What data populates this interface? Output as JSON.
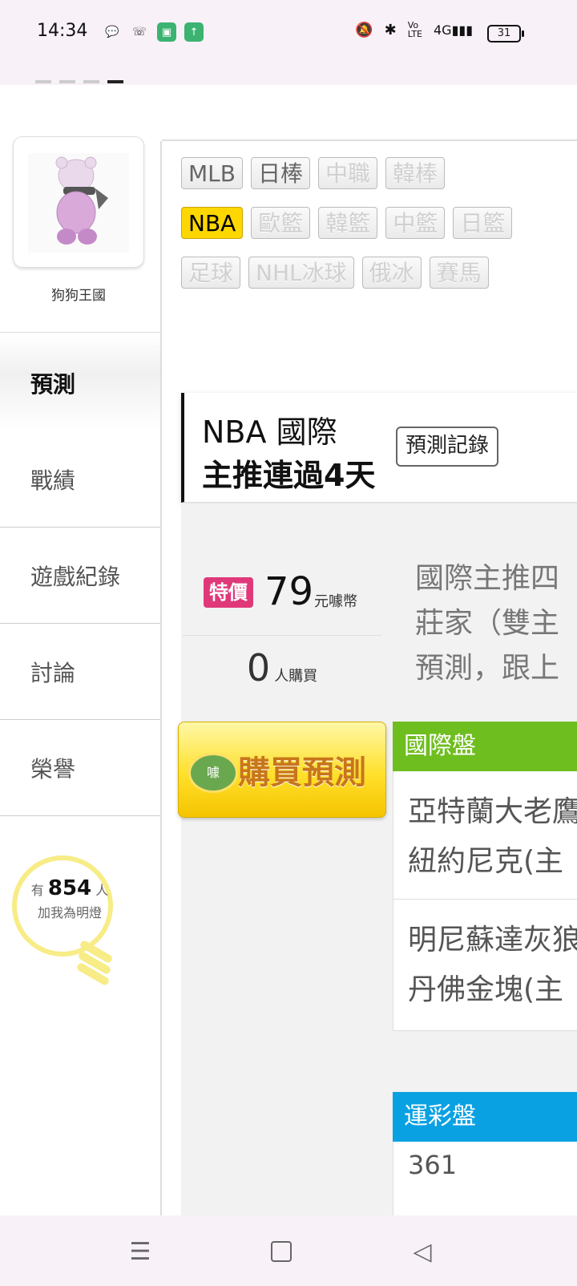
{
  "status_bar": {
    "time": "14:34",
    "battery": "31",
    "left_icons": [
      "chat-bubble-icon",
      "call-icon",
      "green-app-icon",
      "upload-icon"
    ],
    "right_icons": [
      "mute-icon",
      "bluetooth-icon",
      "volte-icon",
      "4g-signal-icon"
    ]
  },
  "profile": {
    "name": "狗狗王國"
  },
  "nav": {
    "items": [
      {
        "label": "預測"
      },
      {
        "label": "戰績"
      },
      {
        "label": "遊戲紀錄"
      },
      {
        "label": "討論"
      },
      {
        "label": "榮譽"
      }
    ]
  },
  "fan": {
    "prefix": "有",
    "count": "854",
    "suffix": "人",
    "label": "加我為明燈"
  },
  "tags": {
    "row1": [
      "MLB",
      "日棒",
      "中職",
      "韓棒"
    ],
    "row2": [
      "NBA",
      "歐籃",
      "韓籃",
      "中籃",
      "日籃"
    ],
    "row3": [
      "足球",
      "NHL冰球",
      "俄冰",
      "賽馬"
    ],
    "selected": "NBA"
  },
  "prediction": {
    "title": "NBA 國際",
    "subtitle": "主推連過4天",
    "record_button": "預測記錄",
    "badge": "特價",
    "price": "79",
    "price_unit": "元噱幣",
    "buyers": "0",
    "buyers_unit": "人購買",
    "description_lines": [
      "國際主推四",
      "莊家（雙主",
      "預測，跟上"
    ],
    "buy_button": "購買預測",
    "buy_coin": "噱"
  },
  "sections": {
    "international": {
      "title": "國際盤",
      "matches": [
        {
          "line1": "亞特蘭大老鷹",
          "line2": "紐約尼克(主"
        },
        {
          "line1": "明尼蘇達灰狼",
          "line2": "丹佛金塊(主"
        }
      ]
    },
    "lottery": {
      "title": "運彩盤",
      "first_number": "361"
    }
  },
  "colors": {
    "accent_yellow": "#ffd700",
    "badge_pink": "#e0397a",
    "section_green": "#6fbe1f",
    "section_blue": "#0aa1e3"
  }
}
